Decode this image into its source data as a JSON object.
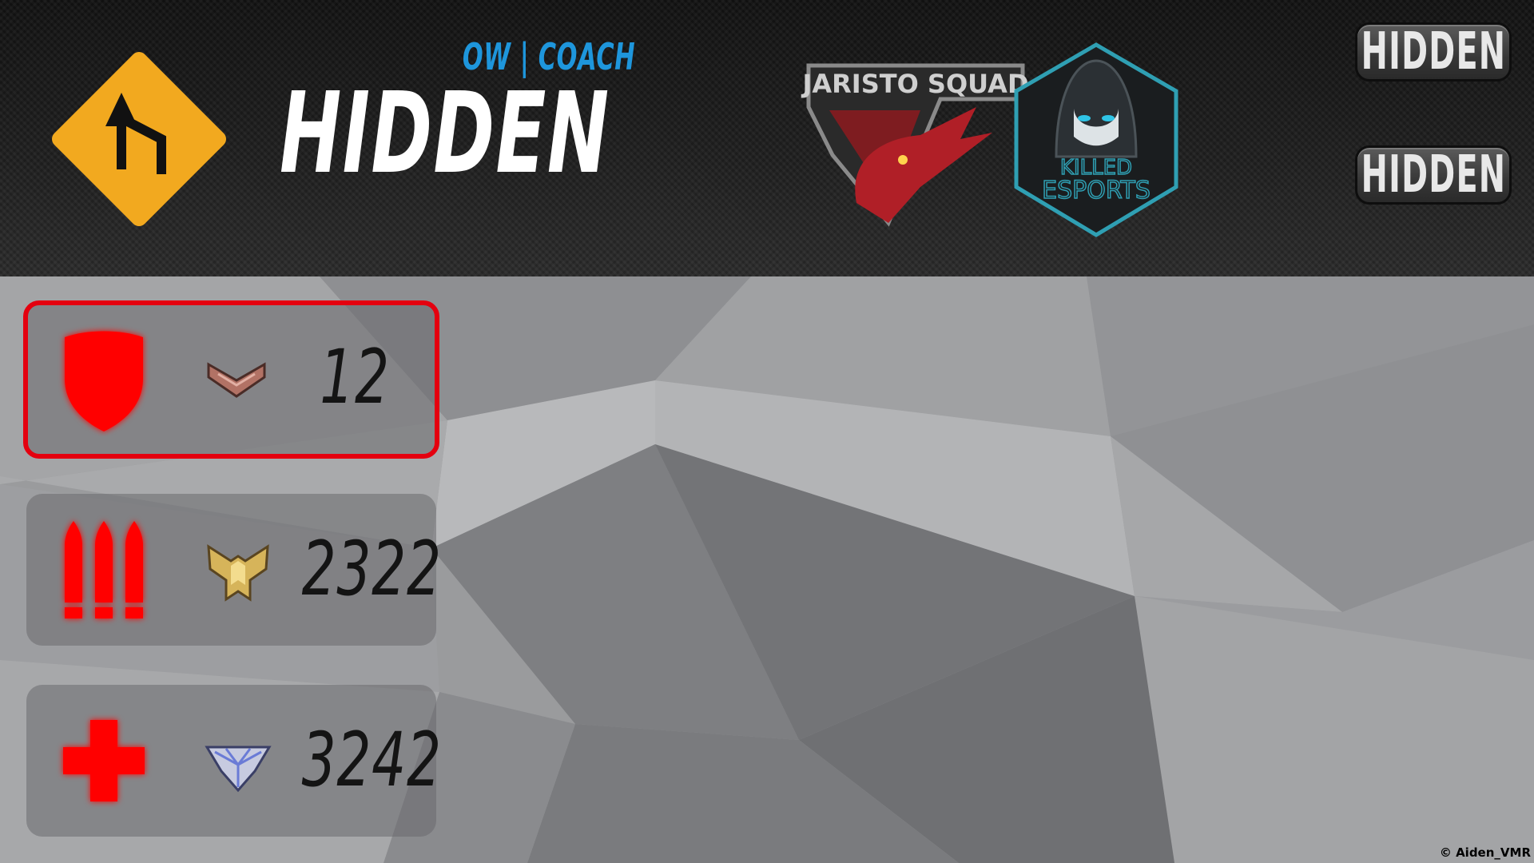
{
  "header": {
    "subtitle": "OW | COACH",
    "player_name": "HIDDEN",
    "role_sign_icon": "winding-road-sign-icon",
    "team_logos": [
      {
        "name": "jaristo-squad-logo",
        "text": "JARISTO SQUAD"
      },
      {
        "name": "killed-esports-logo",
        "text_line1": "KILLED",
        "text_line2": "ESPORTS"
      }
    ],
    "info_pills": [
      {
        "label": "HIDDEN"
      },
      {
        "label": "HIDDEN"
      }
    ]
  },
  "roles": [
    {
      "role": "tank",
      "icon": "tank-shield-icon",
      "rank_icon": "bronze-rank-icon",
      "sr": "12",
      "active": true
    },
    {
      "role": "damage",
      "icon": "damage-bullets-icon",
      "rank_icon": "gold-rank-icon",
      "sr": "2322",
      "active": false
    },
    {
      "role": "support",
      "icon": "support-cross-icon",
      "rank_icon": "diamond-rank-icon",
      "sr": "3242",
      "active": false
    }
  ],
  "colors": {
    "accent_red": "#e4000f",
    "role_icon_red": "#ff0000",
    "subtitle_blue": "#1e96dc",
    "sign_yellow": "#f2a91f"
  },
  "footer": {
    "copyright": "© Aiden_VMR"
  }
}
